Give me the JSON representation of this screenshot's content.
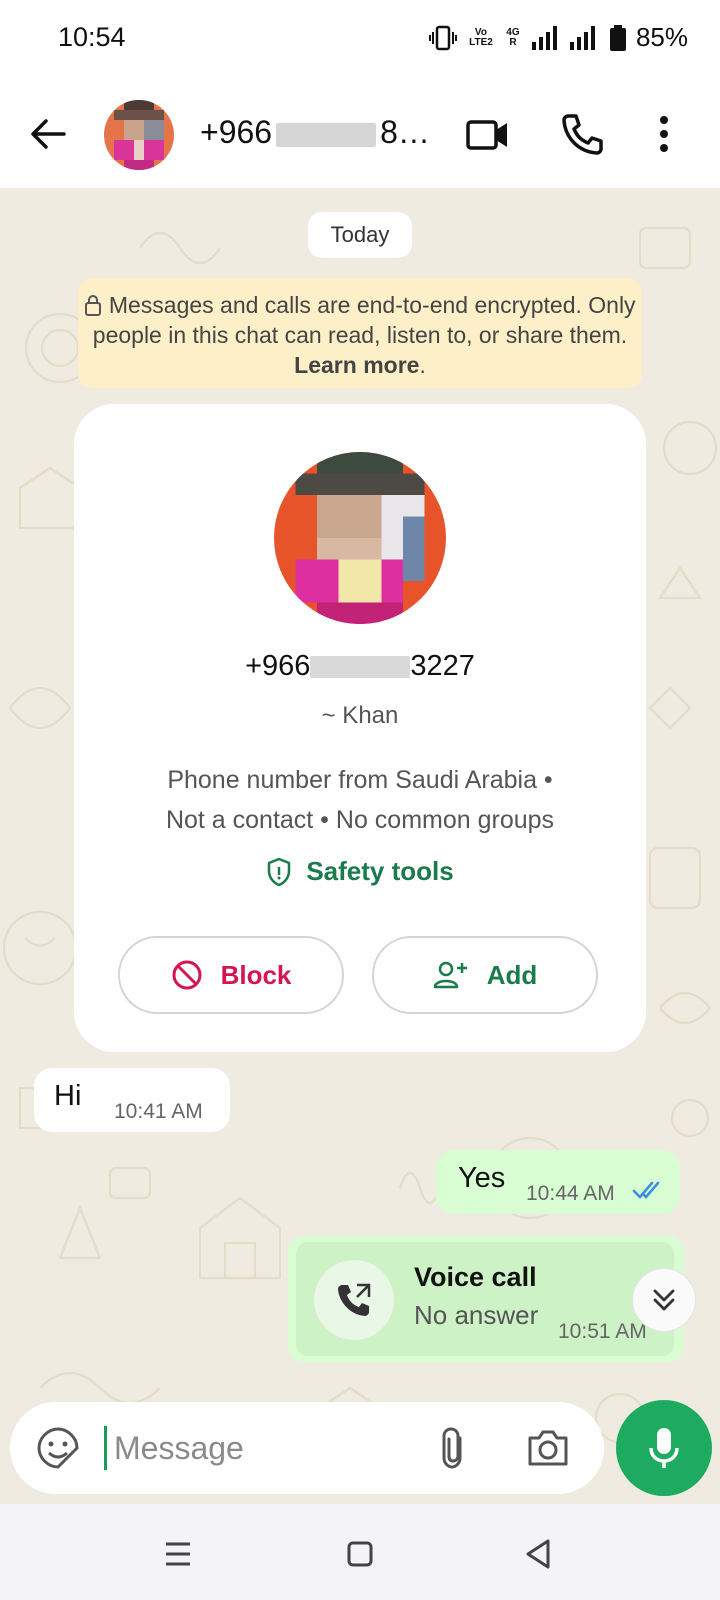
{
  "status_bar": {
    "time": "10:54",
    "volte_tag": "Vo LTE2",
    "net_tag": "4G R",
    "battery": "85%"
  },
  "header": {
    "title_prefix": "+966",
    "title_suffix": "8…",
    "icons": [
      "back-arrow-icon",
      "video-call-icon",
      "phone-call-icon",
      "more-options-icon"
    ]
  },
  "chat": {
    "date_label": "Today",
    "encryption_text": "Messages and calls are end-to-end encrypted. Only people in this chat can read, listen to, or share them.",
    "encryption_link": "Learn more",
    "encryption_end": "."
  },
  "profile_card": {
    "phone_prefix": "+966",
    "phone_suffix": "3227",
    "name": "~ Khan",
    "info_line1": "Phone number from Saudi Arabia •",
    "info_line2": "Not a contact • No common groups",
    "safety_label": "Safety tools",
    "block_label": "Block",
    "add_label": "Add"
  },
  "messages": {
    "incoming_text": "Hi",
    "incoming_time": "10:41 AM",
    "outgoing_text": "Yes",
    "outgoing_time": "10:44 AM",
    "call_title": "Voice call",
    "call_status": "No answer",
    "call_time": "10:51 AM"
  },
  "composer": {
    "placeholder": "Message"
  },
  "colors": {
    "accent_green": "#1daa61",
    "outgoing_bubble": "#d9fdd3",
    "chat_background": "#f0ebe0",
    "block_red": "#d4154f"
  }
}
